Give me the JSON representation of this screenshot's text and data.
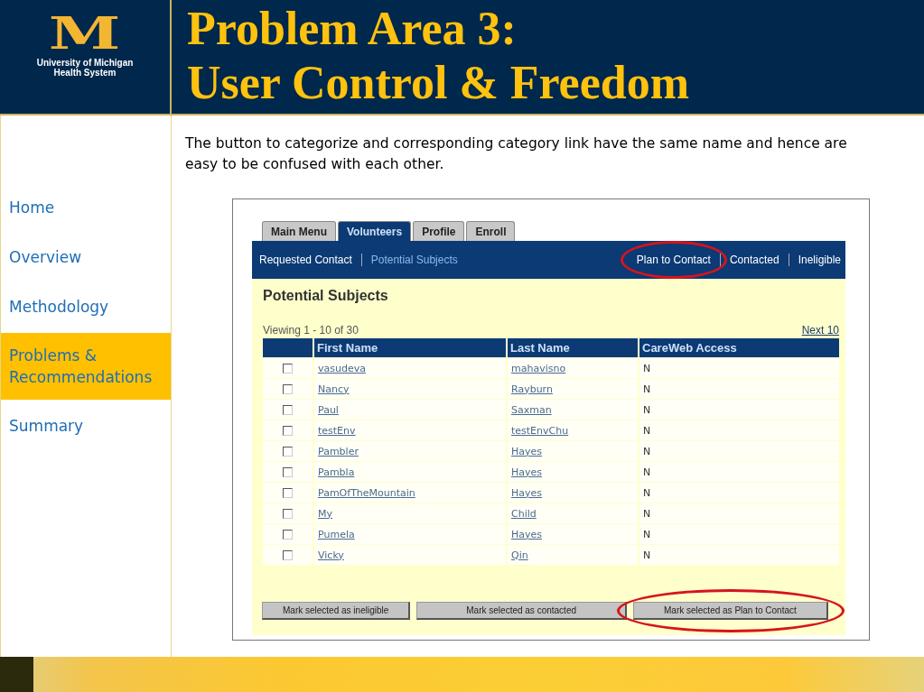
{
  "logo": {
    "mark": "M",
    "lines": [
      "University of Michigan",
      "Health System"
    ]
  },
  "title": [
    "Problem Area 3:",
    "User Control & Freedom"
  ],
  "nav": [
    {
      "label": "Home",
      "selected": false
    },
    {
      "label": "Overview",
      "selected": false
    },
    {
      "label": "Methodology",
      "selected": false
    },
    {
      "label": "Problems & Recommendations",
      "selected": true
    },
    {
      "label": "Summary",
      "selected": false
    }
  ],
  "description": "The button to categorize and corresponding category link have the same name and hence are easy to be confused with each other.",
  "app": {
    "tabs": [
      {
        "label": "Main Menu",
        "selected": false
      },
      {
        "label": "Volunteers",
        "selected": true
      },
      {
        "label": "Profile",
        "selected": false
      },
      {
        "label": "Enroll",
        "selected": false
      }
    ],
    "subnav_left": [
      {
        "label": "Requested Contact",
        "selected": false,
        "circled": false
      },
      {
        "label": "Potential Subjects",
        "selected": true,
        "circled": false
      }
    ],
    "subnav_right": [
      {
        "label": "Plan to Contact",
        "selected": false,
        "circled": true
      },
      {
        "label": "Contacted",
        "selected": false,
        "circled": false
      },
      {
        "label": "Ineligible",
        "selected": false,
        "circled": false
      }
    ],
    "heading": "Potential Subjects",
    "viewing": "Viewing 1 - 10 of 30",
    "next": "Next 10",
    "columns": [
      "First Name",
      "Last Name",
      "CareWeb Access"
    ],
    "rows": [
      {
        "first": "vasudeva",
        "last": "mahavisno",
        "access": "N",
        "checked": false
      },
      {
        "first": "Nancy",
        "last": "Rayburn",
        "access": "N",
        "checked": false
      },
      {
        "first": "Paul",
        "last": "Saxman",
        "access": "N",
        "checked": false
      },
      {
        "first": "testEnv",
        "last": "testEnvChu",
        "access": "N",
        "checked": false
      },
      {
        "first": "Pambler",
        "last": "Hayes",
        "access": "N",
        "checked": false
      },
      {
        "first": "Pambla",
        "last": "Hayes",
        "access": "N",
        "checked": false
      },
      {
        "first": "PamOfTheMountain",
        "last": "Hayes",
        "access": "N",
        "checked": false
      },
      {
        "first": "My",
        "last": "Child",
        "access": "N",
        "checked": false
      },
      {
        "first": "Pumela",
        "last": "Hayes",
        "access": "N",
        "checked": false
      },
      {
        "first": "Vicky",
        "last": "Qin",
        "access": "N",
        "checked": false
      }
    ],
    "buttons": [
      {
        "label": "Mark selected as ineligible",
        "circled": false
      },
      {
        "label": "Mark selected as contacted",
        "circled": false
      },
      {
        "label": "Mark selected as Plan to Contact",
        "circled": true
      }
    ]
  }
}
